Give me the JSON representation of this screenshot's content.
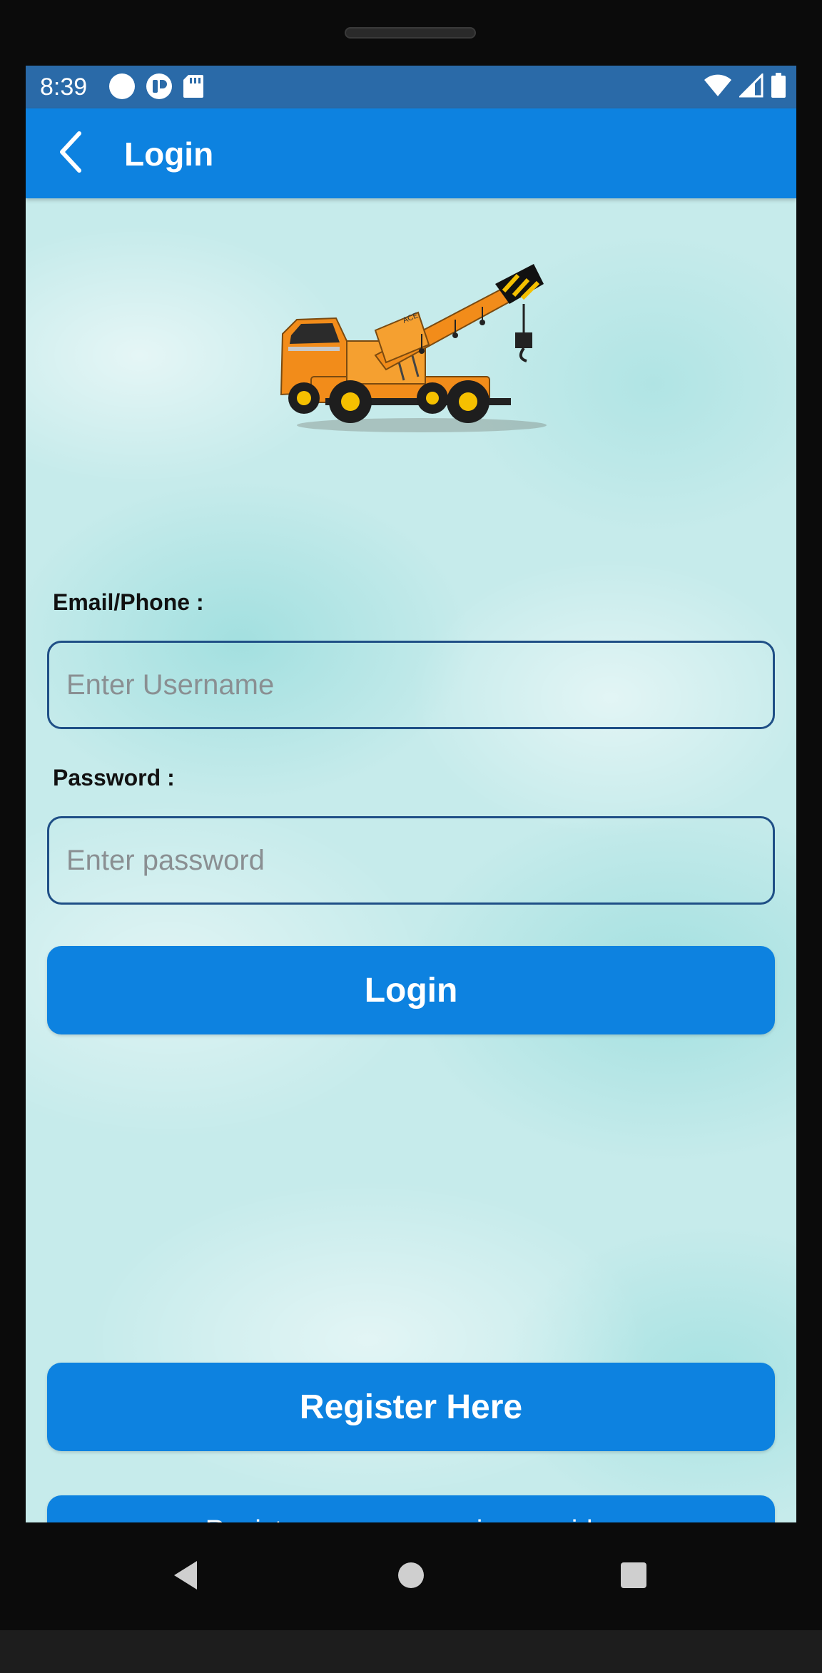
{
  "status_bar": {
    "time": "8:39",
    "left_icons": [
      "circle-icon",
      "shield-app-icon",
      "sd-card-icon"
    ],
    "right_icons": [
      "wifi-icon",
      "signal-icon",
      "battery-icon"
    ]
  },
  "app_bar": {
    "title": "Login",
    "back_icon": "back-arrow-icon"
  },
  "form": {
    "email_label": "Email/Phone :",
    "username_placeholder": "Enter Username",
    "username_value": "",
    "password_label": "Password :",
    "password_placeholder": "Enter password",
    "password_value": ""
  },
  "buttons": {
    "login_label": "Login",
    "register_label": "Register Here",
    "provider_label": "Register as crane service provider"
  },
  "nav_bar": {
    "icons": [
      "nav-back-icon",
      "nav-home-icon",
      "nav-recents-icon"
    ]
  },
  "colors": {
    "status_bar": "#2a6aa8",
    "primary": "#0d82e0",
    "input_border": "#1f4f86",
    "background": "#c6ebeb",
    "crane_body": "#f28c1a"
  }
}
